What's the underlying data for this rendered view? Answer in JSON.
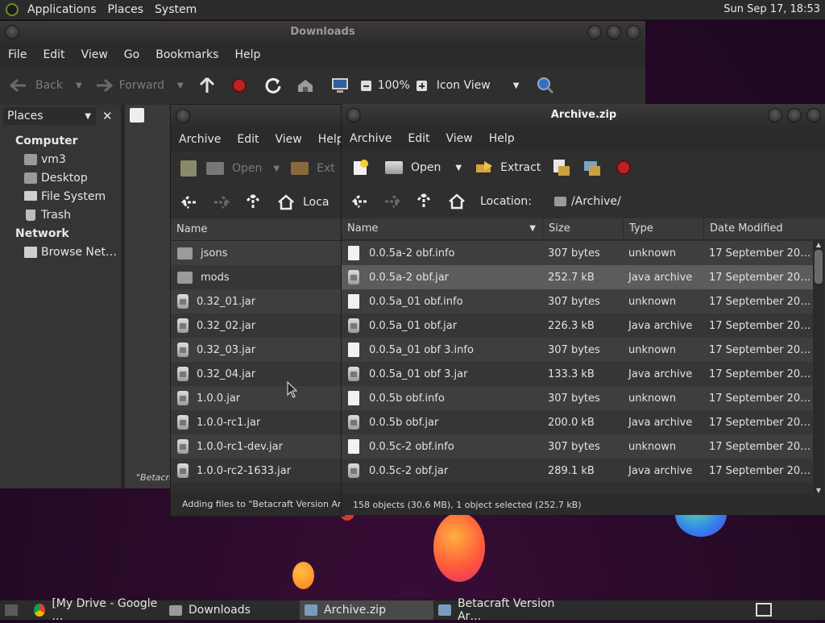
{
  "top_panel": {
    "menus": [
      "Applications",
      "Places",
      "System"
    ],
    "clock": "Sun Sep 17, 18:53"
  },
  "downloads": {
    "title": "Downloads",
    "menu": [
      "File",
      "Edit",
      "View",
      "Go",
      "Bookmarks",
      "Help"
    ],
    "toolbar": {
      "back": "Back",
      "forward": "Forward",
      "zoom": "100%",
      "view_mode": "Icon View"
    },
    "places_label": "Places",
    "places": {
      "computer_label": "Computer",
      "computer_items": [
        "vm3",
        "Desktop",
        "File System",
        "Trash"
      ],
      "network_label": "Network",
      "network_items": [
        "Browse Net…"
      ]
    },
    "status_fragment": "\"Betacra"
  },
  "betacraft": {
    "menu": [
      "Archive",
      "Edit",
      "View",
      "Help"
    ],
    "toolbar": {
      "open": "Open",
      "extract": "Ext"
    },
    "location_label": "Loca",
    "col_name": "Name",
    "items": [
      {
        "name": "jsons",
        "kind": "folder"
      },
      {
        "name": "mods",
        "kind": "folder"
      },
      {
        "name": "0.32_01.jar",
        "kind": "jar"
      },
      {
        "name": "0.32_02.jar",
        "kind": "jar"
      },
      {
        "name": "0.32_03.jar",
        "kind": "jar"
      },
      {
        "name": "0.32_04.jar",
        "kind": "jar"
      },
      {
        "name": "1.0.0.jar",
        "kind": "jar"
      },
      {
        "name": "1.0.0-rc1.jar",
        "kind": "jar"
      },
      {
        "name": "1.0.0-rc1-dev.jar",
        "kind": "jar"
      },
      {
        "name": "1.0.0-rc2-1633.jar",
        "kind": "jar"
      }
    ],
    "status": "Adding files to \"Betacraft Version Archiv"
  },
  "archive": {
    "title": "Archive.zip",
    "menu": [
      "Archive",
      "Edit",
      "View",
      "Help"
    ],
    "toolbar": {
      "open": "Open",
      "extract": "Extract"
    },
    "location_label": "Location:",
    "location_value": "/Archive/",
    "columns": [
      "Name",
      "Size",
      "Type",
      "Date Modified"
    ],
    "rows": [
      {
        "name": "0.0.5a-2 obf.info",
        "size": "307 bytes",
        "type": "unknown",
        "date": "17 September 202…",
        "kind": "file"
      },
      {
        "name": "0.0.5a-2 obf.jar",
        "size": "252.7 kB",
        "type": "Java archive",
        "date": "17 September 202…",
        "kind": "jar",
        "selected": true
      },
      {
        "name": "0.0.5a_01 obf.info",
        "size": "307 bytes",
        "type": "unknown",
        "date": "17 September 202…",
        "kind": "file"
      },
      {
        "name": "0.0.5a_01 obf.jar",
        "size": "226.3 kB",
        "type": "Java archive",
        "date": "17 September 202…",
        "kind": "jar"
      },
      {
        "name": "0.0.5a_01 obf 3.info",
        "size": "307 bytes",
        "type": "unknown",
        "date": "17 September 202…",
        "kind": "file"
      },
      {
        "name": "0.0.5a_01 obf 3.jar",
        "size": "133.3 kB",
        "type": "Java archive",
        "date": "17 September 202…",
        "kind": "jar"
      },
      {
        "name": "0.0.5b obf.info",
        "size": "307 bytes",
        "type": "unknown",
        "date": "17 September 202…",
        "kind": "file"
      },
      {
        "name": "0.0.5b obf.jar",
        "size": "200.0 kB",
        "type": "Java archive",
        "date": "17 September 202…",
        "kind": "jar"
      },
      {
        "name": "0.0.5c-2 obf.info",
        "size": "307 bytes",
        "type": "unknown",
        "date": "17 September 202…",
        "kind": "file"
      },
      {
        "name": "0.0.5c-2 obf.jar",
        "size": "289.1 kB",
        "type": "Java archive",
        "date": "17 September 202…",
        "kind": "jar"
      }
    ],
    "status": "158 objects (30.6 MB), 1 object selected (252.7 kB)"
  },
  "taskbar": {
    "tasks": [
      "[My Drive - Google …",
      "Downloads",
      "Archive.zip",
      "Betacraft Version Ar…"
    ]
  }
}
